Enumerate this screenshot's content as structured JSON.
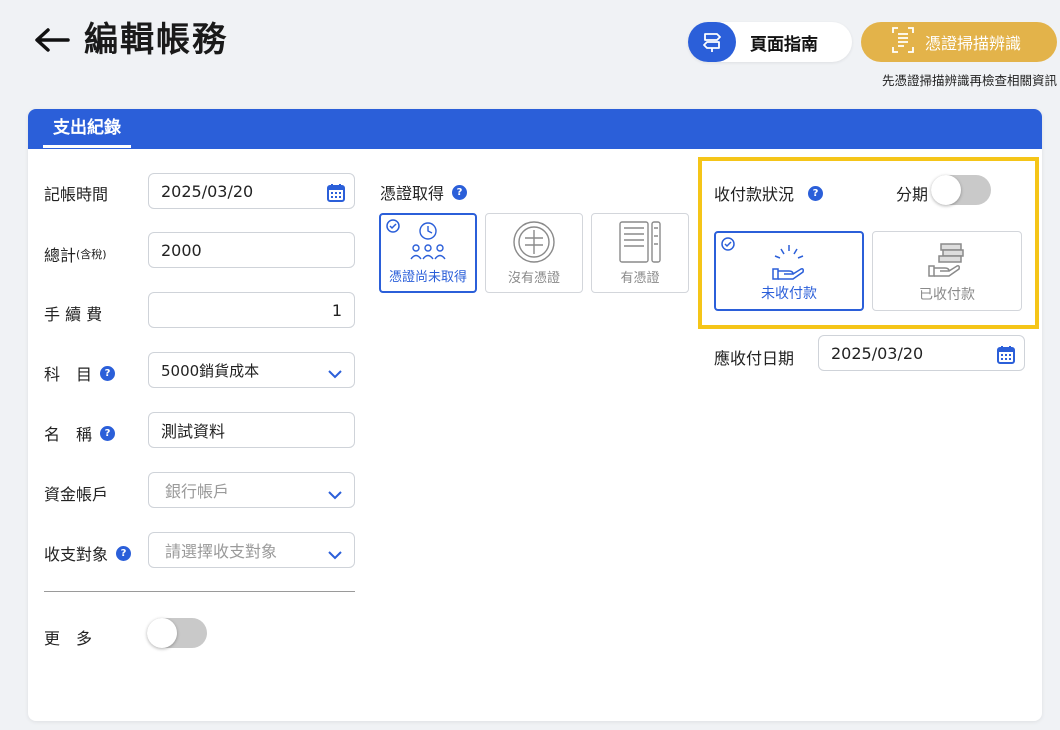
{
  "header": {
    "title": "編輯帳務",
    "guide_label": "頁面指南",
    "scan_label": "憑證掃描辨識",
    "scan_hint": "先憑證掃描辨識再檢查相關資訊"
  },
  "card": {
    "tab": "支出紀錄"
  },
  "form": {
    "date_label": "記帳時間",
    "date_value": "2025/03/20",
    "total_label": "總計",
    "total_suffix": "(含稅)",
    "total_value": "2000",
    "fee_label": "手 續 費",
    "fee_value": "1",
    "subject_label": "科　目",
    "subject_value": "5000銷貨成本",
    "name_label": "名　稱",
    "name_value": "測試資料",
    "account_label": "資金帳戶",
    "account_placeholder": "銀行帳戶",
    "target_label": "收支對象",
    "target_placeholder": "請選擇收支對象",
    "more_label": "更　多"
  },
  "voucher": {
    "label": "憑證取得",
    "options": [
      {
        "label": "憑證尚未取得",
        "selected": true
      },
      {
        "label": "沒有憑證",
        "selected": false
      },
      {
        "label": "有憑證",
        "selected": false
      }
    ]
  },
  "payment": {
    "label": "收付款狀況",
    "installment_label": "分期",
    "options": [
      {
        "label": "未收付款",
        "selected": true
      },
      {
        "label": "已收付款",
        "selected": false
      }
    ],
    "due_label": "應收付日期",
    "due_value": "2025/03/20"
  },
  "colors": {
    "primary": "#2b5fd9",
    "scan": "#e3b34a",
    "highlight": "#f5c518"
  }
}
